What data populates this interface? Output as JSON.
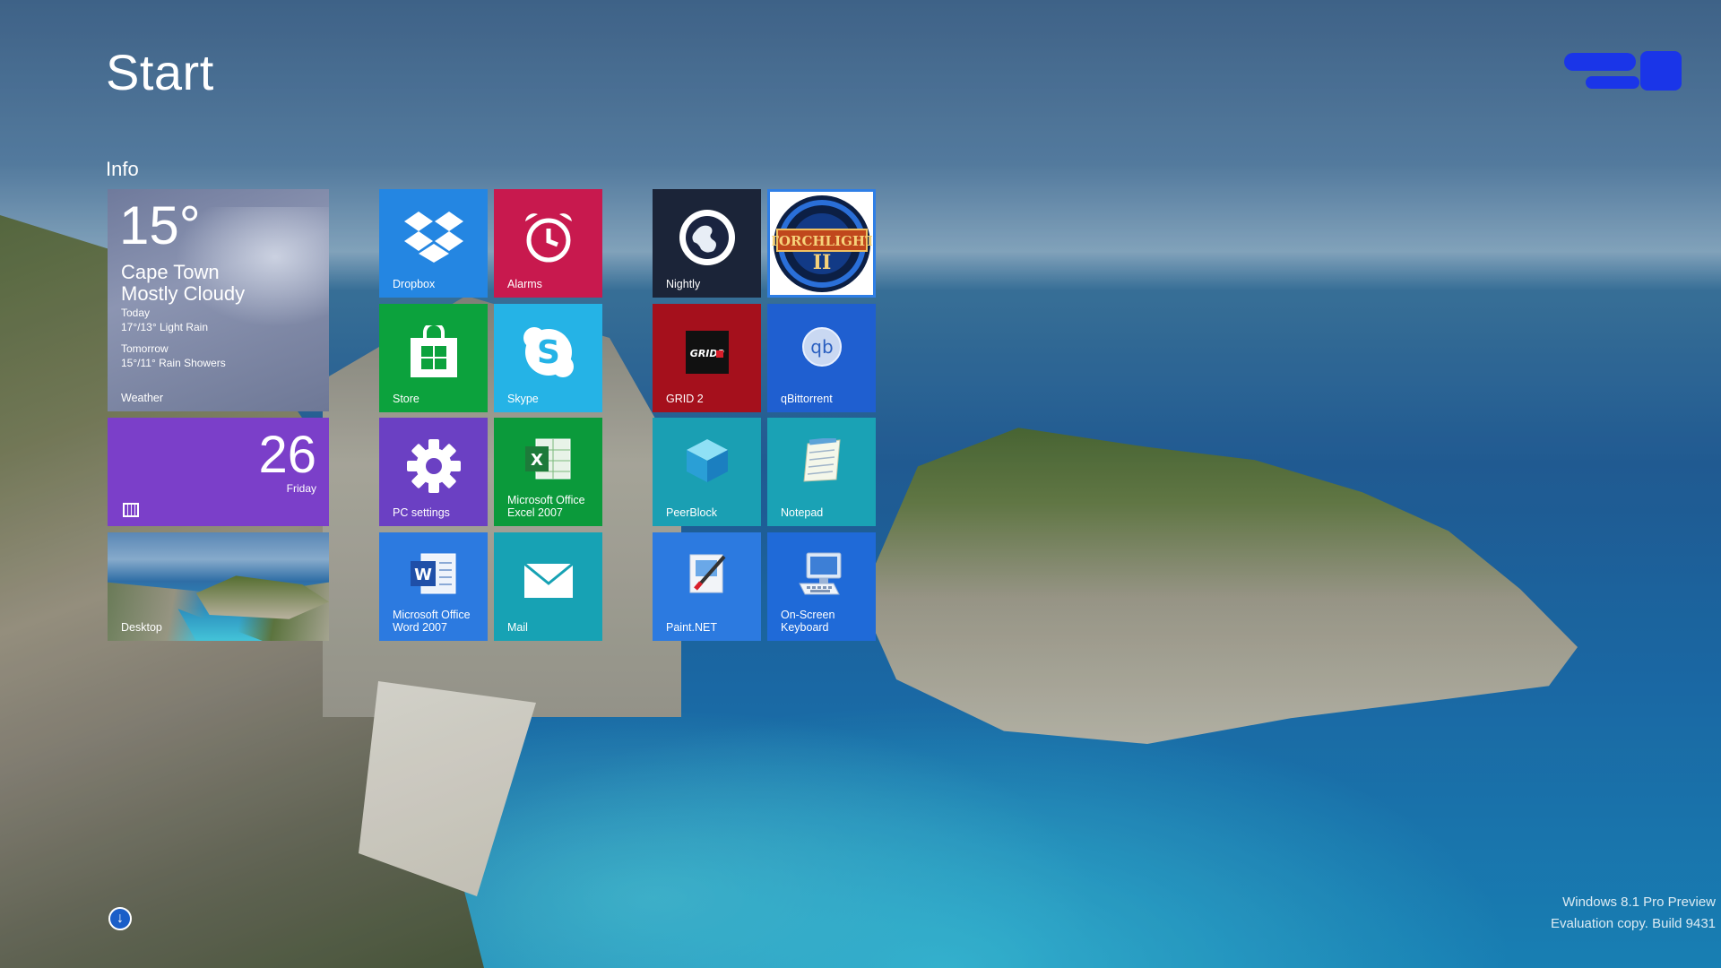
{
  "header": {
    "title": "Start",
    "group_title": "Info"
  },
  "tiles": {
    "weather": {
      "temp": "15°",
      "city": "Cape Town",
      "condition": "Mostly Cloudy",
      "today_label": "Today",
      "today_forecast": "17°/13° Light Rain",
      "tomorrow_label": "Tomorrow",
      "tomorrow_forecast": "15°/11° Rain Showers",
      "label": "Weather"
    },
    "calendar": {
      "day": "26",
      "weekday": "Friday"
    },
    "desktop": {
      "label": "Desktop"
    },
    "dropbox": {
      "label": "Dropbox"
    },
    "alarms": {
      "label": "Alarms"
    },
    "store": {
      "label": "Store"
    },
    "skype": {
      "label": "Skype"
    },
    "pc_settings": {
      "label": "PC settings"
    },
    "excel": {
      "label": "Microsoft Office Excel 2007"
    },
    "word": {
      "label": "Microsoft Office Word 2007"
    },
    "mail": {
      "label": "Mail"
    },
    "nightly": {
      "label": "Nightly"
    },
    "torchlight": {
      "label": "TORCHLIGHT II"
    },
    "grid2": {
      "label": "GRID 2",
      "logo_text": "GRID2"
    },
    "qbittorrent": {
      "label": "qBittorrent",
      "logo_text": "qb"
    },
    "peerblock": {
      "label": "PeerBlock"
    },
    "notepad": {
      "label": "Notepad"
    },
    "paintnet": {
      "label": "Paint.NET"
    },
    "osk": {
      "label": "On-Screen Keyboard"
    }
  },
  "watermark": {
    "line1": "Windows 8.1 Pro Preview",
    "line2": "Evaluation copy. Build 9431"
  },
  "colors": {
    "accent_blue": "#2486e2",
    "alarms_red": "#c8194e",
    "store_green": "#0ca23d",
    "skype_cyan": "#25b3e6",
    "settings_purple": "#6b40c3",
    "calendar_purple": "#7b3fc9",
    "teal": "#17a2b4",
    "grid_red": "#a5101c",
    "user_tile_blue": "#1a35e8"
  },
  "icons": {
    "dropbox": "dropbox-icon",
    "alarms": "alarm-clock-icon",
    "store": "store-bag-icon",
    "skype": "skype-icon",
    "pc_settings": "gear-icon",
    "excel": "excel-icon",
    "word": "word-icon",
    "mail": "envelope-icon",
    "nightly": "globe-icon",
    "peerblock": "cube-icon",
    "notepad": "notepad-icon",
    "paintnet": "paint-icon",
    "osk": "keyboard-monitor-icon",
    "scroll": "arrow-down-circle-icon"
  }
}
